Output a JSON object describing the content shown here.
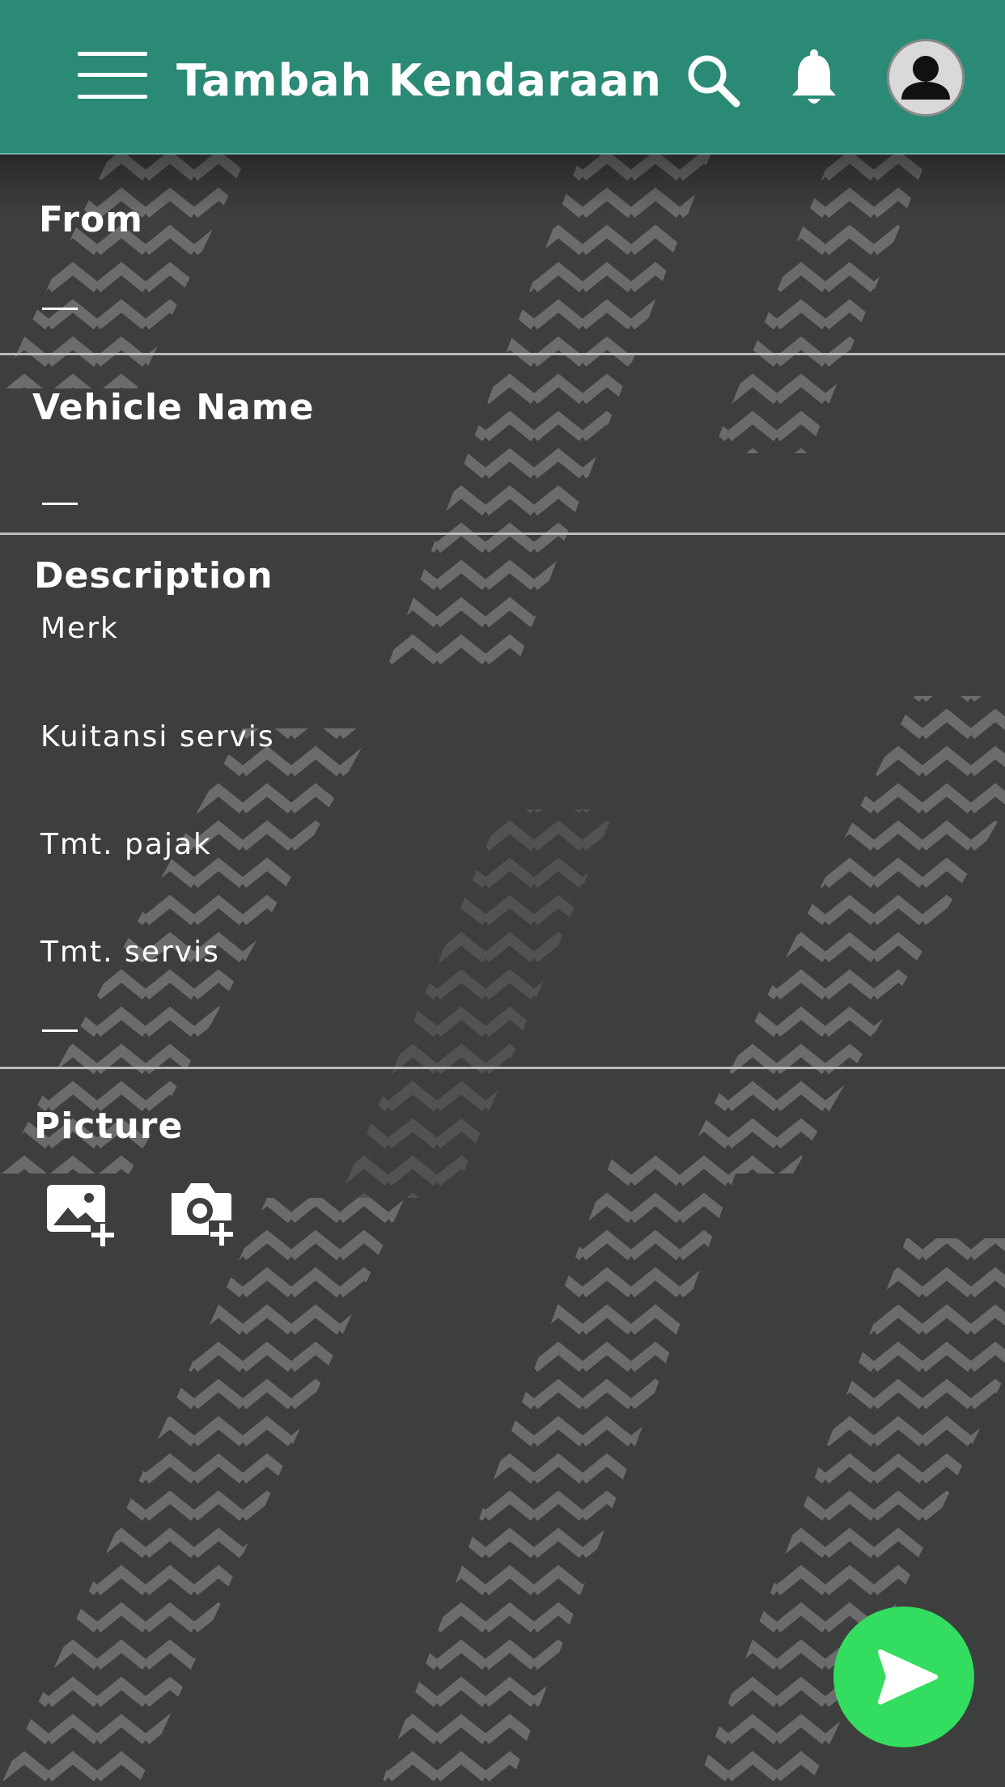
{
  "header": {
    "title": "Tambah Kendaraan",
    "menu_icon": "hamburger-menu-icon",
    "search_icon": "search-icon",
    "notification_icon": "bell-icon",
    "avatar_icon": "user-avatar-icon"
  },
  "form": {
    "from": {
      "label": "From",
      "value": ""
    },
    "vehicle_name": {
      "label": "Vehicle Name",
      "value": ""
    },
    "description": {
      "label": "Description",
      "items": [
        "Merk",
        "Kuitansi servis",
        "Tmt. pajak",
        "Tmt. servis"
      ]
    },
    "picture": {
      "label": "Picture",
      "add_image_icon": "add-image-icon",
      "add_camera_icon": "add-photo-camera-icon"
    }
  },
  "send_button": {
    "icon": "send-icon"
  },
  "colors": {
    "header_bg": "#2a8a76",
    "page_bg": "#3d3e3e",
    "send_button_bg": "#33dd5f",
    "divider": "#b9bcbc",
    "text": "#ffffff"
  }
}
